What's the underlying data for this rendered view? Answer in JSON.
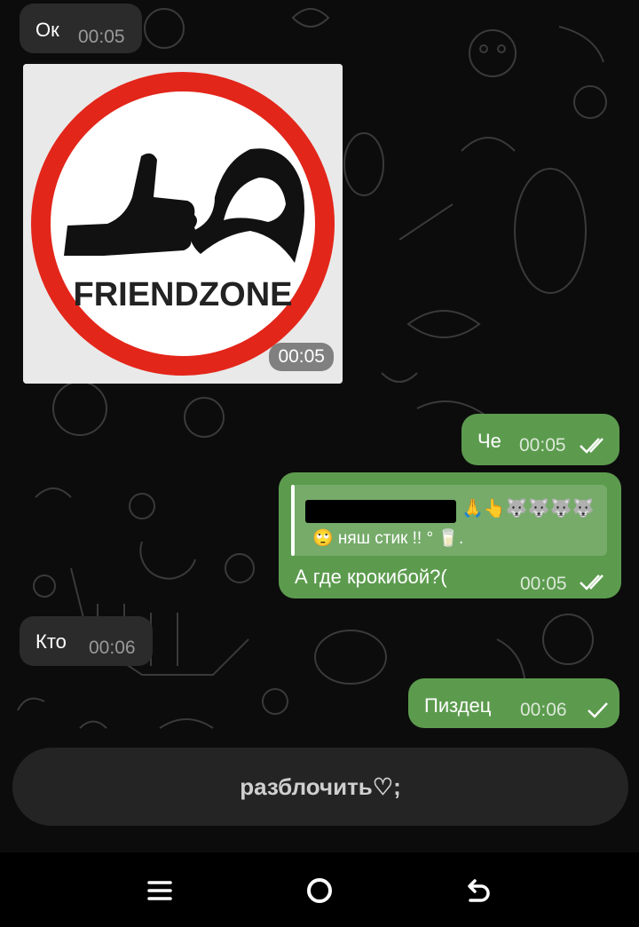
{
  "colors": {
    "incoming_bubble": "#2b2b2b",
    "outgoing_bubble": "#5c9b4e",
    "background": "#0c0c0c"
  },
  "messages": {
    "m1": {
      "text": "Ок",
      "time": "00:05"
    },
    "m2": {
      "image_text": "FRIENDZONE",
      "time": "00:05"
    },
    "m3": {
      "text": "Че",
      "time": "00:05",
      "status": "read"
    },
    "m4": {
      "reply_emojis": "🙏👆🐺🐺🐺🐺",
      "reply_line2": "🙄 няш стик !! ° 🥛.",
      "text": "А где крокибой?(",
      "time": "00:05",
      "status": "read"
    },
    "m5": {
      "text": "Кто",
      "time": "00:06"
    },
    "m6": {
      "text": "Пиздец",
      "time": "00:06",
      "status": "sent"
    }
  },
  "unblock_button": {
    "label": "разблочить♡;"
  },
  "navbar": {
    "icons": [
      "menu-icon",
      "home-icon",
      "back-icon"
    ]
  }
}
